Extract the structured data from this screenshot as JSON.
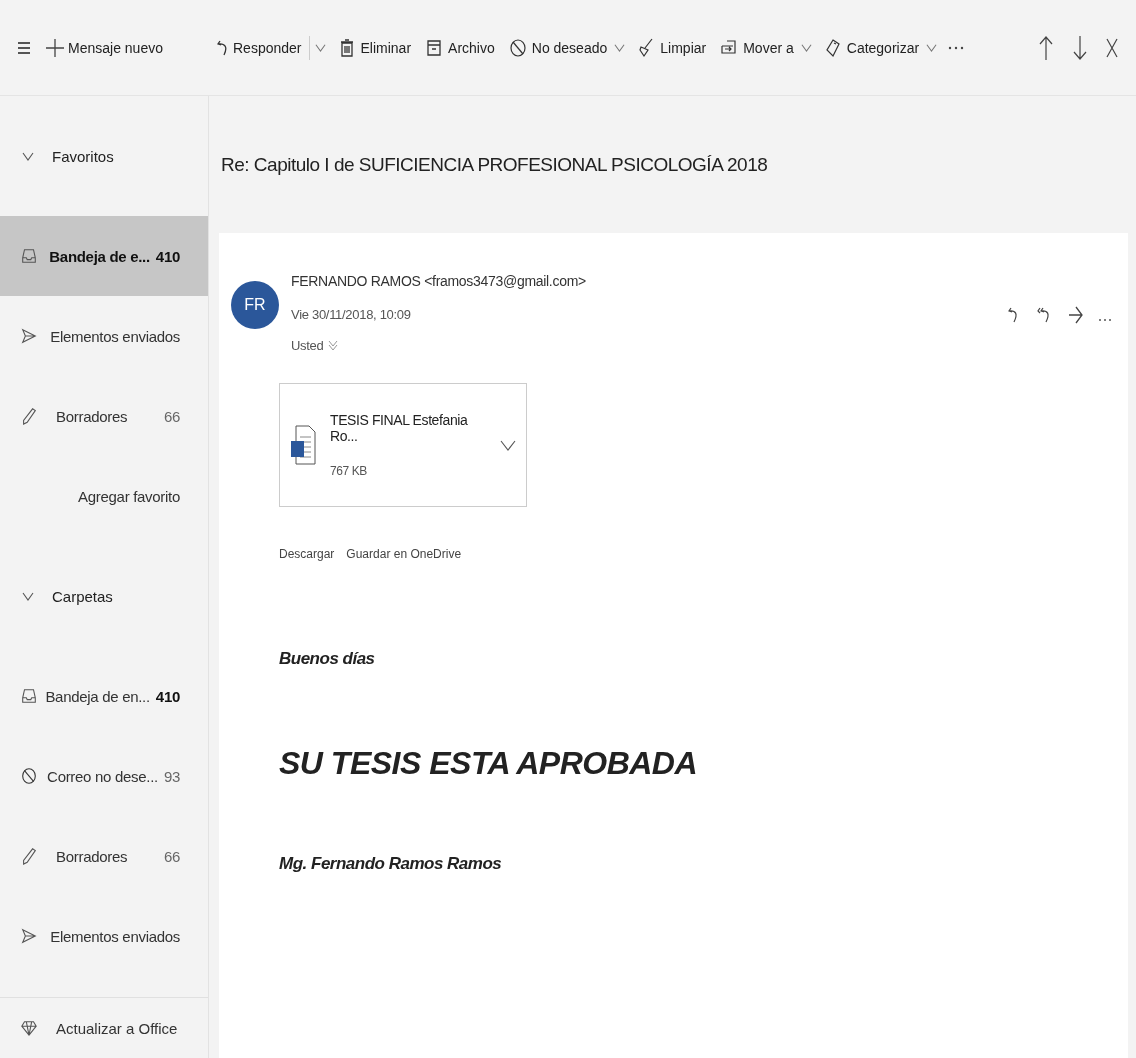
{
  "toolbar": {
    "new_message": "Mensaje nuevo",
    "actions": [
      {
        "label": "Responder",
        "kind": "reply",
        "dropdown": true,
        "split": true
      },
      {
        "label": "Eliminar",
        "kind": "delete",
        "dropdown": false,
        "split": false
      },
      {
        "label": "Archivo",
        "kind": "archive",
        "dropdown": false,
        "split": false
      },
      {
        "label": "No deseado",
        "kind": "junk",
        "dropdown": true,
        "split": false
      },
      {
        "label": "Limpiar",
        "kind": "sweep",
        "dropdown": false,
        "split": false
      },
      {
        "label": "Mover a",
        "kind": "move",
        "dropdown": true,
        "split": false
      },
      {
        "label": "Categorizar",
        "kind": "category",
        "dropdown": true,
        "split": false
      }
    ]
  },
  "sidebar": {
    "sections": [
      {
        "title": "Favoritos",
        "expanded": true,
        "items": [
          {
            "label": "Bandeja de e...",
            "count": "410",
            "kind": "inbox",
            "selected": true,
            "unread": true
          },
          {
            "label": "Elementos enviados",
            "kind": "sent",
            "selected": false
          },
          {
            "label": "Borradores",
            "count": "66",
            "kind": "draft",
            "selected": false,
            "unread": false
          },
          {
            "label": "Agregar favorito",
            "kind": "add",
            "selected": false
          }
        ]
      },
      {
        "title": "Carpetas",
        "expanded": true,
        "items": [
          {
            "label": "Bandeja de en...",
            "count": "410",
            "kind": "inbox",
            "selected": false,
            "unread": true
          },
          {
            "label": "Correo no dese...",
            "count": "93",
            "kind": "junk",
            "selected": false,
            "unread": false
          },
          {
            "label": "Borradores",
            "count": "66",
            "kind": "draft",
            "selected": false,
            "unread": false
          },
          {
            "label": "Elementos enviados",
            "kind": "sent",
            "selected": false
          }
        ]
      }
    ],
    "footer": "Actualizar a Office"
  },
  "message": {
    "subject": "Re: Capitulo I de SUFICIENCIA PROFESIONAL PSICOLOGÍA 2018",
    "avatar": "FR",
    "sender": "FERNANDO RAMOS <framos3473@gmail.com>",
    "date": "Vie 30/11/2018, 10:09",
    "recipient": "Usted",
    "attachment": {
      "name": "TESIS FINAL Estefania Ro...",
      "size": "767 KB"
    },
    "attachment_actions": [
      "Descargar",
      "Guardar en OneDrive"
    ],
    "body": [
      {
        "kind": "greeting",
        "text": "Buenos días"
      },
      {
        "kind": "headline",
        "text": "SU TESIS ESTA APROBADA"
      },
      {
        "kind": "signature",
        "text": "Mg. Fernando Ramos Ramos"
      }
    ]
  }
}
